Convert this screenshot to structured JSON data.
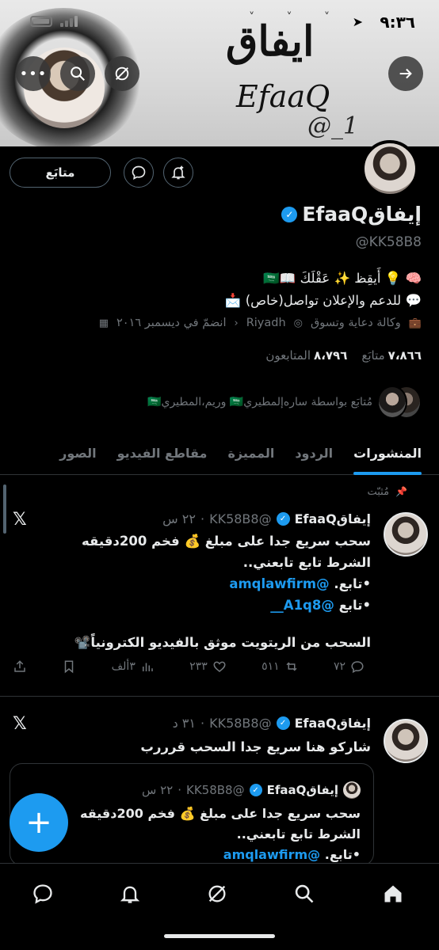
{
  "status_bar": {
    "time": "٩:٣٦"
  },
  "banner": {
    "title_ar": "ايفاق",
    "title_en": "EfaaQ",
    "handle_art": "@_1"
  },
  "profile": {
    "display_name": "إيفاقEfaaQ",
    "handle": "@KK58B8",
    "follow_label": "متابَع",
    "bio_line1": "🧠 💡 أَيقِظ ✨ عَقْلَكَ 📖🇸🇦",
    "bio_line2": "💬 للدعم والإعلان تواصل(خاص) 📩",
    "category": "وكالة دعاية وتسوق",
    "location": "Riyadh",
    "joined": "انضمّ في ديسمبر ٢٠١٦",
    "following_count": "٧،٨٦٦",
    "following_label": "متابَع",
    "followers_count": "٨،٧٩٦",
    "followers_label": "المتابعون",
    "followed_by": "مُتابَع بواسطة ساره‌إلمطيري🇸🇦 وريم،المطيري🇸🇦"
  },
  "tabs": [
    {
      "label": "المنشورات",
      "active": true
    },
    {
      "label": "الردود",
      "active": false
    },
    {
      "label": "المميزة",
      "active": false
    },
    {
      "label": "مقاطع الفيديو",
      "active": false
    },
    {
      "label": "الصور",
      "active": false
    }
  ],
  "post1": {
    "pinned_label": "مُثبّت",
    "name": "إيفاقEfaaQ",
    "handle": "@KK58B8",
    "time": "٢٢ س",
    "line1": "سحب سريع جدا على مبلغ 💰 فخم 200دقيقه",
    "line2": "الشرط تابع تابعني..",
    "line3_prefix": "•تابع. ",
    "line3_link": "@amqlawfirm",
    "line4_prefix": "•تابع  ",
    "line4_link": "@A1q8__",
    "line5": "السحب من الريتويت موثق بالفيديو الكترونياً📽️",
    "replies": "٧٢",
    "reposts": "٥١١",
    "likes": "٢٣٣",
    "views": "٣ألف"
  },
  "post2": {
    "name": "إيفاقEfaaQ",
    "handle": "@KK58B8",
    "time": "٣١ د",
    "text": "شاركو هنا سريع جدا السحب قرررب",
    "quote": {
      "name": "إيفاقEfaaQ",
      "handle": "@KK58B8",
      "time": "٢٢ س",
      "line1": "سحب سريع جدا على مبلغ 💰 فخم 200دقيقه",
      "line2": "الشرط تابع تابعني..",
      "line3_prefix": "•تابع. ",
      "line3_link": "@amqlawfirm"
    }
  },
  "fab_label": "+"
}
